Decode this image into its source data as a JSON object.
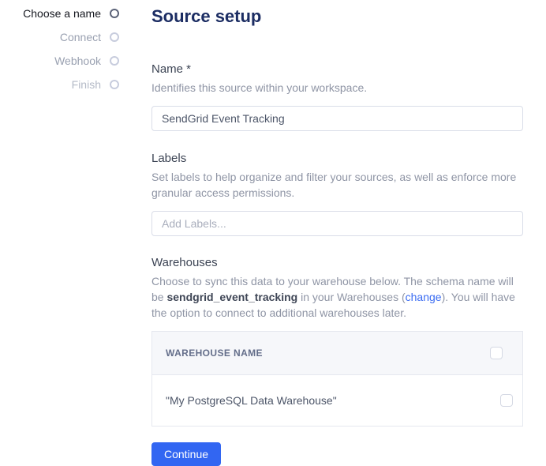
{
  "steps": [
    {
      "label": "Choose a name",
      "state": "active"
    },
    {
      "label": "Connect",
      "state": "upcoming"
    },
    {
      "label": "Webhook",
      "state": "upcoming"
    },
    {
      "label": "Finish",
      "state": "far"
    }
  ],
  "header": {
    "title": "Source setup"
  },
  "name_section": {
    "label": "Name *",
    "description": "Identifies this source within your workspace.",
    "value": "SendGrid Event Tracking"
  },
  "labels_section": {
    "label": "Labels",
    "description": "Set labels to help organize and filter your sources, as well as enforce more granular access permissions.",
    "placeholder": "Add Labels..."
  },
  "warehouses_section": {
    "label": "Warehouses",
    "desc_before_schema": "Choose to sync this data to your warehouse below. The schema name will be ",
    "schema_name": "sendgrid_event_tracking",
    "desc_mid": " in your Warehouses (",
    "change_link": "change",
    "desc_after": "). You will have the option to connect to additional warehouses later.",
    "table": {
      "header": "WAREHOUSE NAME",
      "rows": [
        {
          "name": "\"My PostgreSQL Data Warehouse\"",
          "checked": false
        }
      ]
    }
  },
  "actions": {
    "continue_label": "Continue"
  },
  "colors": {
    "accent_blue": "#3266f2",
    "title_navy": "#1c2d63",
    "link_blue": "#3b6cf2",
    "label_slate": "#3c4454",
    "desc_gray": "#8f95a5",
    "table_header_bg": "#f6f7fa",
    "border_gray": "#d9dde8"
  }
}
